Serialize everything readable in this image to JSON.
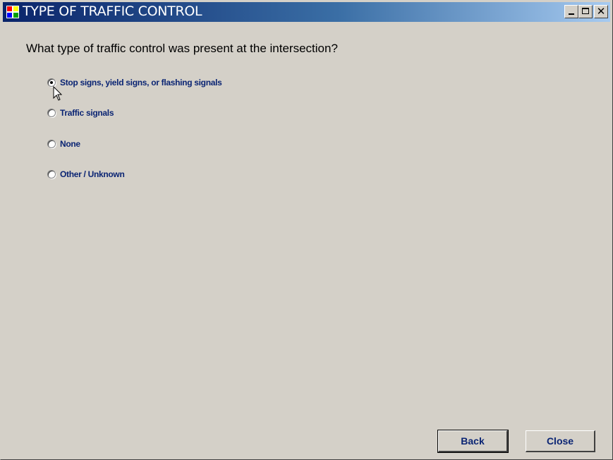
{
  "window": {
    "title": "TYPE OF TRAFFIC CONTROL",
    "controls": {
      "minimize": "minimize-icon",
      "maximize": "maximize-icon",
      "close": "close-icon",
      "close_glyph": "✕"
    }
  },
  "form": {
    "question": "What type of traffic control was present at the intersection?",
    "options": [
      {
        "label": "Stop signs, yield signs, or flashing signals",
        "selected": true
      },
      {
        "label": "Traffic signals",
        "selected": false
      },
      {
        "label": "None",
        "selected": false
      },
      {
        "label": "Other / Unknown",
        "selected": false
      }
    ]
  },
  "buttons": {
    "back": "Back",
    "close": "Close"
  },
  "colors": {
    "title_bar_start": "#0a246a",
    "title_bar_end": "#a6caf0",
    "label_text": "#0a2473",
    "face": "#d4d0c8"
  }
}
